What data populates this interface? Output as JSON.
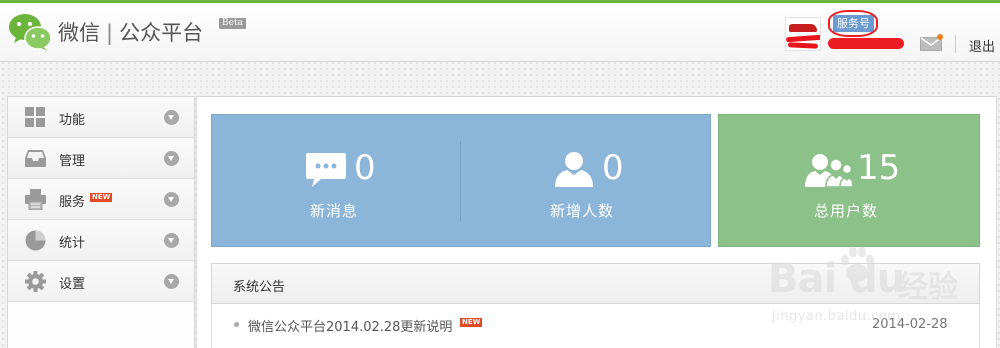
{
  "header": {
    "brand_name": "微信",
    "separator": "|",
    "platform_name": "公众平台",
    "beta_badge": "Beta",
    "account_type_badge": "服务号",
    "logout_label": "退出",
    "mail_icon": "mail-icon",
    "accent_color": "#6ab43a"
  },
  "sidebar": {
    "items": [
      {
        "label": "功能",
        "icon": "grid-icon"
      },
      {
        "label": "管理",
        "icon": "inbox-icon"
      },
      {
        "label": "服务",
        "icon": "printer-icon",
        "badge": "NEW"
      },
      {
        "label": "统计",
        "icon": "pie-chart-icon"
      },
      {
        "label": "设置",
        "icon": "gear-icon"
      }
    ]
  },
  "stats": {
    "new_messages": {
      "value": "0",
      "label": "新消息",
      "icon": "chat-bubble-icon"
    },
    "new_users": {
      "value": "0",
      "label": "新增人数",
      "icon": "user-icon"
    },
    "total_users": {
      "value": "15",
      "label": "总用户数",
      "icon": "users-group-icon"
    },
    "blue_color": "#8cb6d9",
    "green_color": "#8cc18a"
  },
  "notice": {
    "title": "系统公告",
    "items": [
      {
        "text": "微信公众平台2014.02.28更新说明",
        "badge": "NEW",
        "date": "2014-02-28"
      }
    ]
  },
  "watermark": {
    "logo_text": "Bai  du",
    "cn_text": "经验",
    "url": "jingyan.baidu.com"
  }
}
